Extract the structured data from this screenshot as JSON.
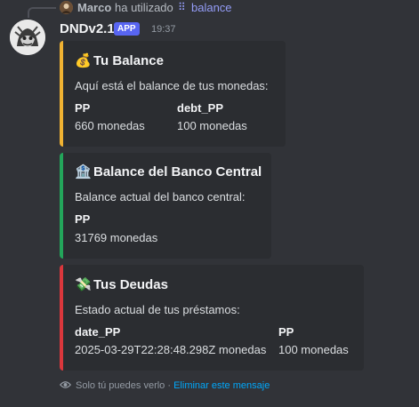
{
  "reply": {
    "user": "Marco",
    "action": "ha utilizado",
    "command": "balance"
  },
  "message": {
    "author": "DNDv2.1",
    "badge": "APP",
    "time": "19:37"
  },
  "embeds": [
    {
      "color": "#f0b232",
      "emoji": "💰",
      "title": "Tu Balance",
      "description": "Aquí está el balance de tus monedas:",
      "fields": [
        {
          "name": "PP",
          "value": "660 monedas"
        },
        {
          "name": "debt_PP",
          "value": "100 monedas"
        }
      ]
    },
    {
      "color": "#23a55a",
      "emoji": "🏦",
      "title": "Balance del Banco Central",
      "description": "Balance actual del banco central:",
      "fields": [
        {
          "name": "PP",
          "value": "31769 monedas"
        }
      ]
    },
    {
      "color": "#da373c",
      "emoji": "💸",
      "title": "Tus Deudas",
      "description": "Estado actual de tus préstamos:",
      "fields": [
        {
          "name": "date_PP",
          "value": "2025-03-29T22:28:48.298Z monedas"
        },
        {
          "name": "PP",
          "value": "100 monedas"
        }
      ]
    }
  ],
  "footer": {
    "eye_icon": "eye-icon",
    "text": "Solo tú puedes verlo",
    "separator": "·",
    "link": "Eliminar este mensaje"
  }
}
